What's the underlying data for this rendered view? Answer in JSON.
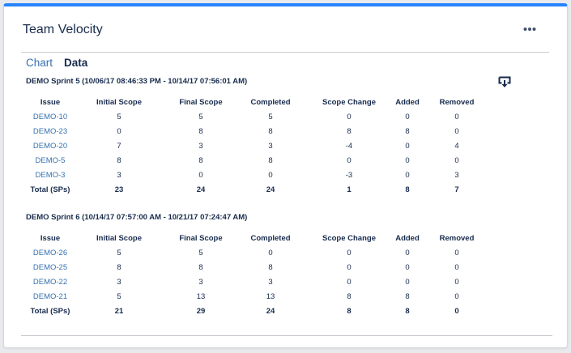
{
  "gadget": {
    "title": "Team Velocity"
  },
  "tabs": [
    {
      "label": "Chart",
      "active": false
    },
    {
      "label": "Data",
      "active": true
    }
  ],
  "icons": {
    "more": "more-horizontal-icon",
    "download": "download-icon"
  },
  "colors": {
    "accent": "#2684ff",
    "link": "#3572b0",
    "text": "#172b4d"
  },
  "columns": [
    "Issue",
    "Initial Scope",
    "Final Scope",
    "Completed",
    "Scope Change",
    "Added",
    "Removed"
  ],
  "sprints": [
    {
      "title": "DEMO Sprint 5 (10/06/17 08:46:33 PM - 10/14/17 07:56:01 AM)",
      "rows": [
        [
          "DEMO-10",
          "5",
          "5",
          "5",
          "0",
          "0",
          "0"
        ],
        [
          "DEMO-23",
          "0",
          "8",
          "8",
          "8",
          "8",
          "0"
        ],
        [
          "DEMO-20",
          "7",
          "3",
          "3",
          "-4",
          "0",
          "4"
        ],
        [
          "DEMO-5",
          "8",
          "8",
          "8",
          "0",
          "0",
          "0"
        ],
        [
          "DEMO-3",
          "3",
          "0",
          "0",
          "-3",
          "0",
          "3"
        ]
      ],
      "total": [
        "Total (SPs)",
        "23",
        "24",
        "24",
        "1",
        "8",
        "7"
      ]
    },
    {
      "title": "DEMO Sprint 6 (10/14/17 07:57:00 AM - 10/21/17 07:24:47 AM)",
      "rows": [
        [
          "DEMO-26",
          "5",
          "5",
          "0",
          "0",
          "0",
          "0"
        ],
        [
          "DEMO-25",
          "8",
          "8",
          "8",
          "0",
          "0",
          "0"
        ],
        [
          "DEMO-22",
          "3",
          "3",
          "3",
          "0",
          "0",
          "0"
        ],
        [
          "DEMO-21",
          "5",
          "13",
          "13",
          "8",
          "8",
          "0"
        ]
      ],
      "total": [
        "Total (SPs)",
        "21",
        "29",
        "24",
        "8",
        "8",
        "0"
      ]
    }
  ]
}
